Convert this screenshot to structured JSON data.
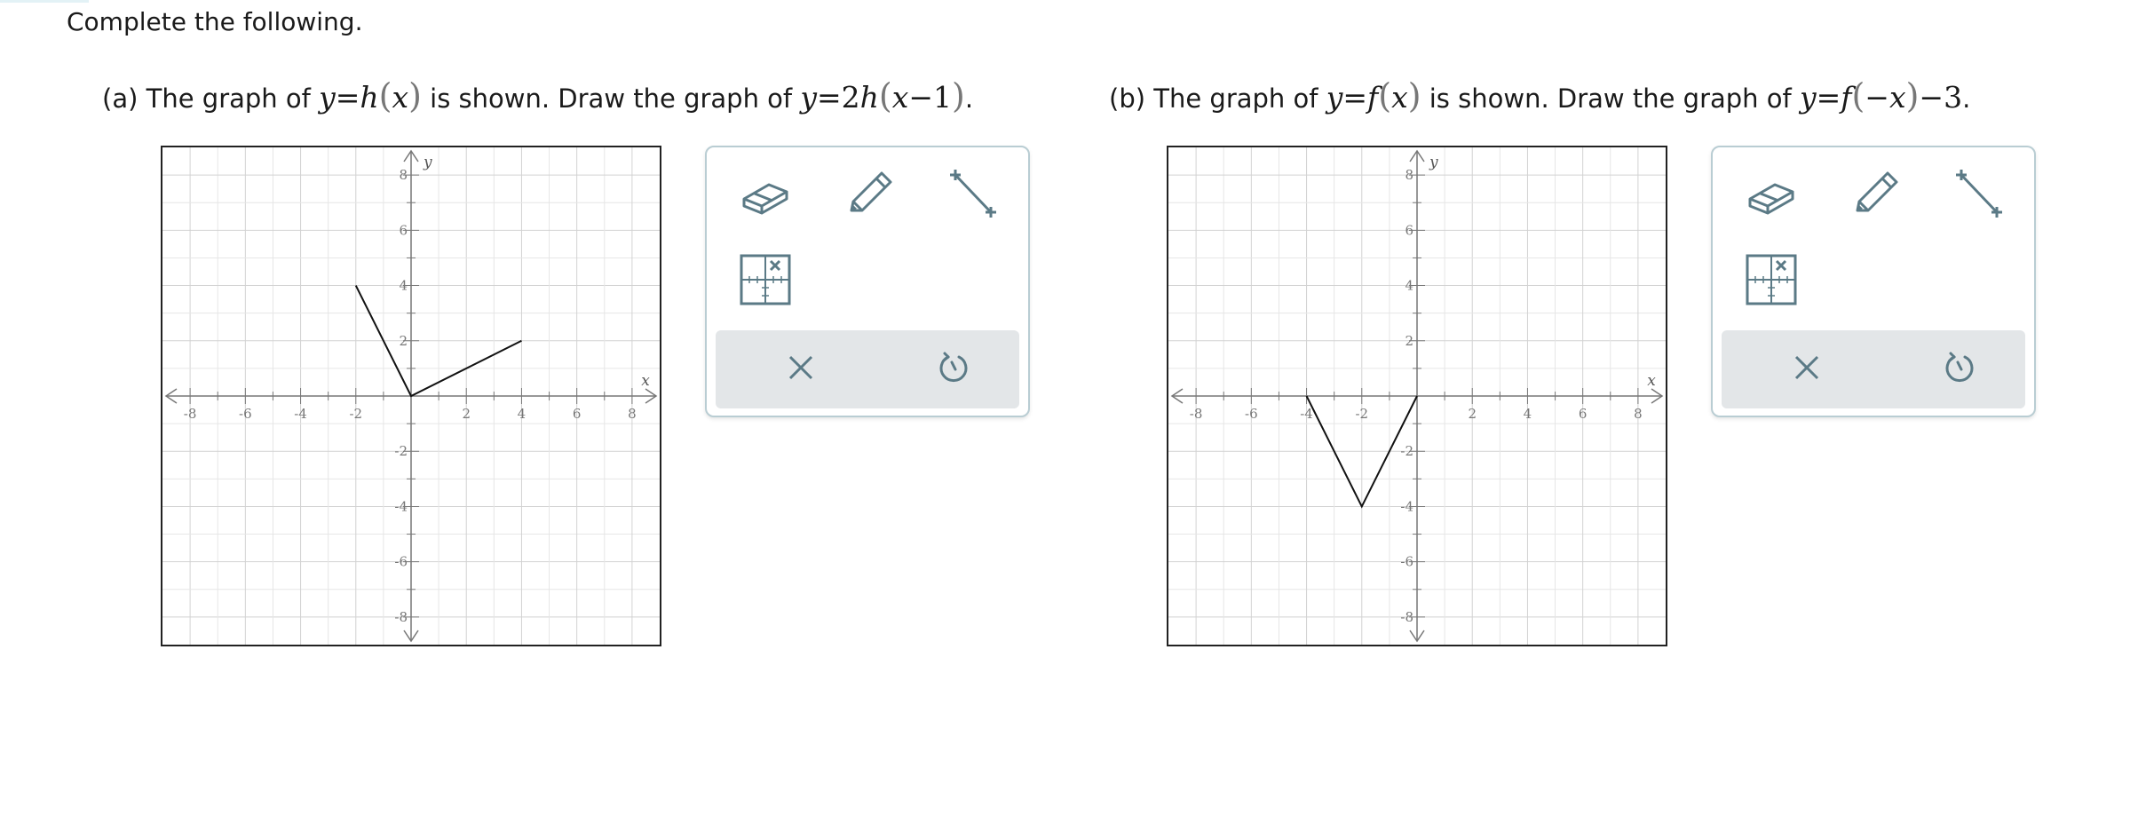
{
  "instruction": "Complete the following.",
  "parts": [
    {
      "label": "(a)",
      "text_before": "The graph of",
      "given_fn": {
        "y": "y",
        "eq": "=",
        "name": "h",
        "lp": "(",
        "arg": "x",
        "rp": ")"
      },
      "text_middle": "is shown. Draw the graph of",
      "target_fn": {
        "y": "y",
        "eq": "=",
        "coef": "2",
        "name": "h",
        "lp": "(",
        "arg": "x",
        "op": "−",
        "num": "1",
        "rp": ")"
      },
      "period": ".",
      "graph": {
        "xlabel": "x",
        "ylabel": "y",
        "x_ticks": [
          "-8",
          "-6",
          "-4",
          "-2",
          "2",
          "4",
          "6",
          "8"
        ],
        "y_ticks": [
          "8",
          "6",
          "4",
          "2",
          "-2",
          "-4",
          "-6",
          "-8"
        ],
        "range": [
          -9,
          9
        ],
        "polyline": [
          [
            -2,
            4
          ],
          [
            0,
            0
          ],
          [
            4,
            2
          ]
        ]
      }
    },
    {
      "label": "(b)",
      "text_before": "The graph of",
      "given_fn": {
        "y": "y",
        "eq": "=",
        "name": "f",
        "lp": "(",
        "arg": "x",
        "rp": ")"
      },
      "text_middle": "is shown. Draw the graph of",
      "target_fn": {
        "y": "y",
        "eq": "=",
        "name": "f",
        "lp": "(",
        "neg": "−",
        "arg": "x",
        "rp": ")",
        "op": "−",
        "num": "3"
      },
      "period": ".",
      "graph": {
        "xlabel": "x",
        "ylabel": "y",
        "x_ticks": [
          "-8",
          "-6",
          "-4",
          "-2",
          "2",
          "4",
          "6",
          "8"
        ],
        "y_ticks": [
          "8",
          "6",
          "4",
          "2",
          "-2",
          "-4",
          "-6",
          "-8"
        ],
        "range": [
          -9,
          9
        ],
        "polyline": [
          [
            -4,
            0
          ],
          [
            -2,
            -4
          ],
          [
            0,
            0
          ]
        ]
      }
    }
  ],
  "tools": {
    "eraser": "eraser-icon",
    "pencil": "pencil-icon",
    "line": "line-segment-icon",
    "grid": "graph-grid-icon",
    "clear": "close-icon",
    "undo": "undo-icon",
    "icon_color": "#5b7a86"
  }
}
